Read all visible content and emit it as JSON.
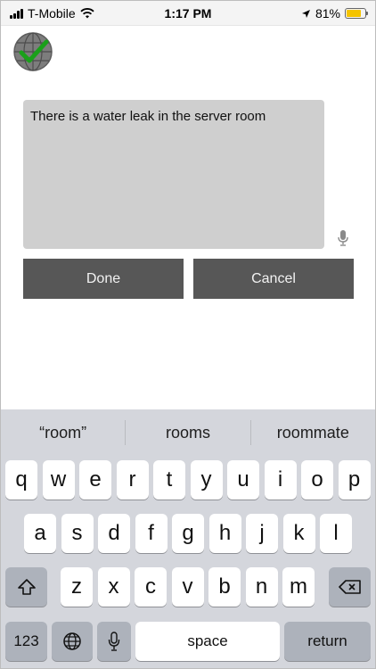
{
  "status_bar": {
    "carrier": "T-Mobile",
    "time": "1:17 PM",
    "battery_percent": "81%",
    "battery_level": 0.81
  },
  "app": {
    "note_text": "There is a water leak in the server room",
    "done_label": "Done",
    "cancel_label": "Cancel",
    "accent_color": "#575757"
  },
  "keyboard": {
    "suggestions": [
      "“room”",
      "rooms",
      "roommate"
    ],
    "row1": [
      "q",
      "w",
      "e",
      "r",
      "t",
      "y",
      "u",
      "i",
      "o",
      "p"
    ],
    "row2": [
      "a",
      "s",
      "d",
      "f",
      "g",
      "h",
      "j",
      "k",
      "l"
    ],
    "row3": [
      "z",
      "x",
      "c",
      "v",
      "b",
      "n",
      "m"
    ],
    "numbers_label": "123",
    "space_label": "space",
    "return_label": "return"
  }
}
